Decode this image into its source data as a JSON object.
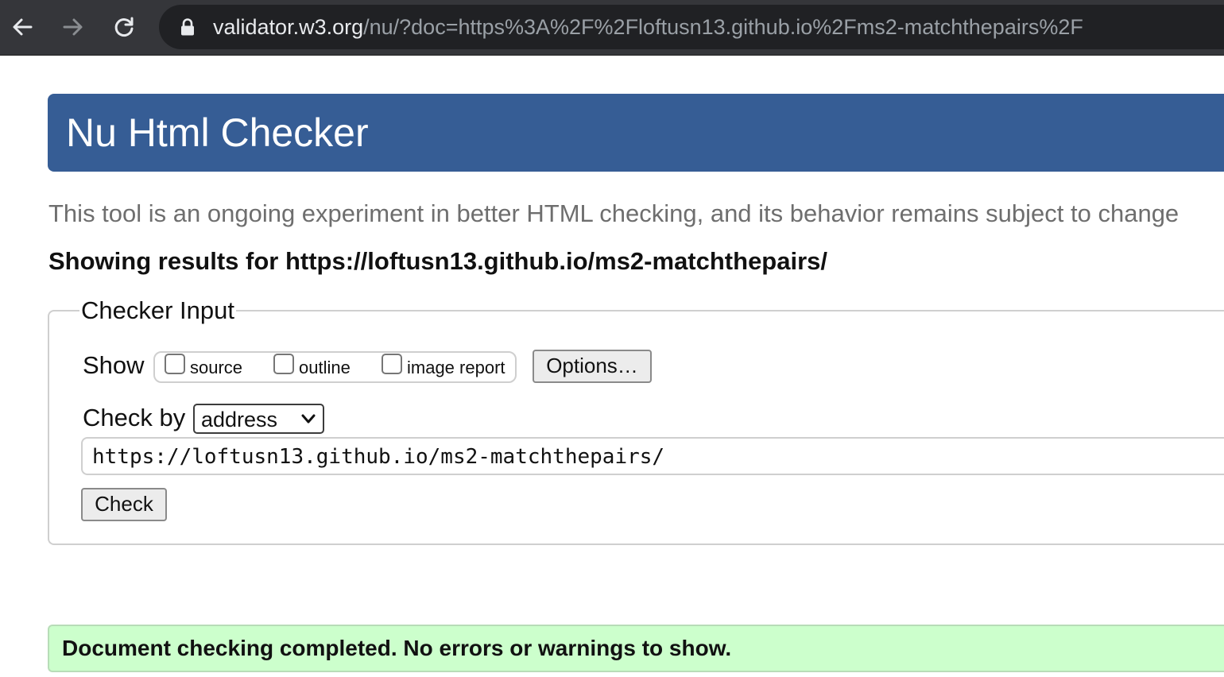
{
  "browser": {
    "url_host": "validator.w3.org",
    "url_path": "/nu/?doc=https%3A%2F%2Floftusn13.github.io%2Fms2-matchthepairs%2F",
    "icons": [
      "back-arrow-icon",
      "forward-arrow-icon",
      "reload-icon",
      "lock-icon"
    ]
  },
  "header": {
    "title": "Nu Html Checker",
    "color": "#365d95"
  },
  "intro_text": "This tool is an ongoing experiment in better HTML checking, and its behavior remains subject to change",
  "results_heading": "Showing results for https://loftusn13.github.io/ms2-matchthepairs/",
  "checker_input": {
    "legend": "Checker Input",
    "show_label": "Show",
    "show_options": [
      {
        "label": "source",
        "checked": false
      },
      {
        "label": "outline",
        "checked": false
      },
      {
        "label": "image report",
        "checked": false
      }
    ],
    "options_button": "Options…",
    "check_by_label": "Check by",
    "check_by_selected": "address",
    "url_value": "https://loftusn13.github.io/ms2-matchthepairs/",
    "check_button": "Check"
  },
  "status": {
    "message": "Document checking completed. No errors or warnings to show.",
    "color": "#ccffcc"
  }
}
